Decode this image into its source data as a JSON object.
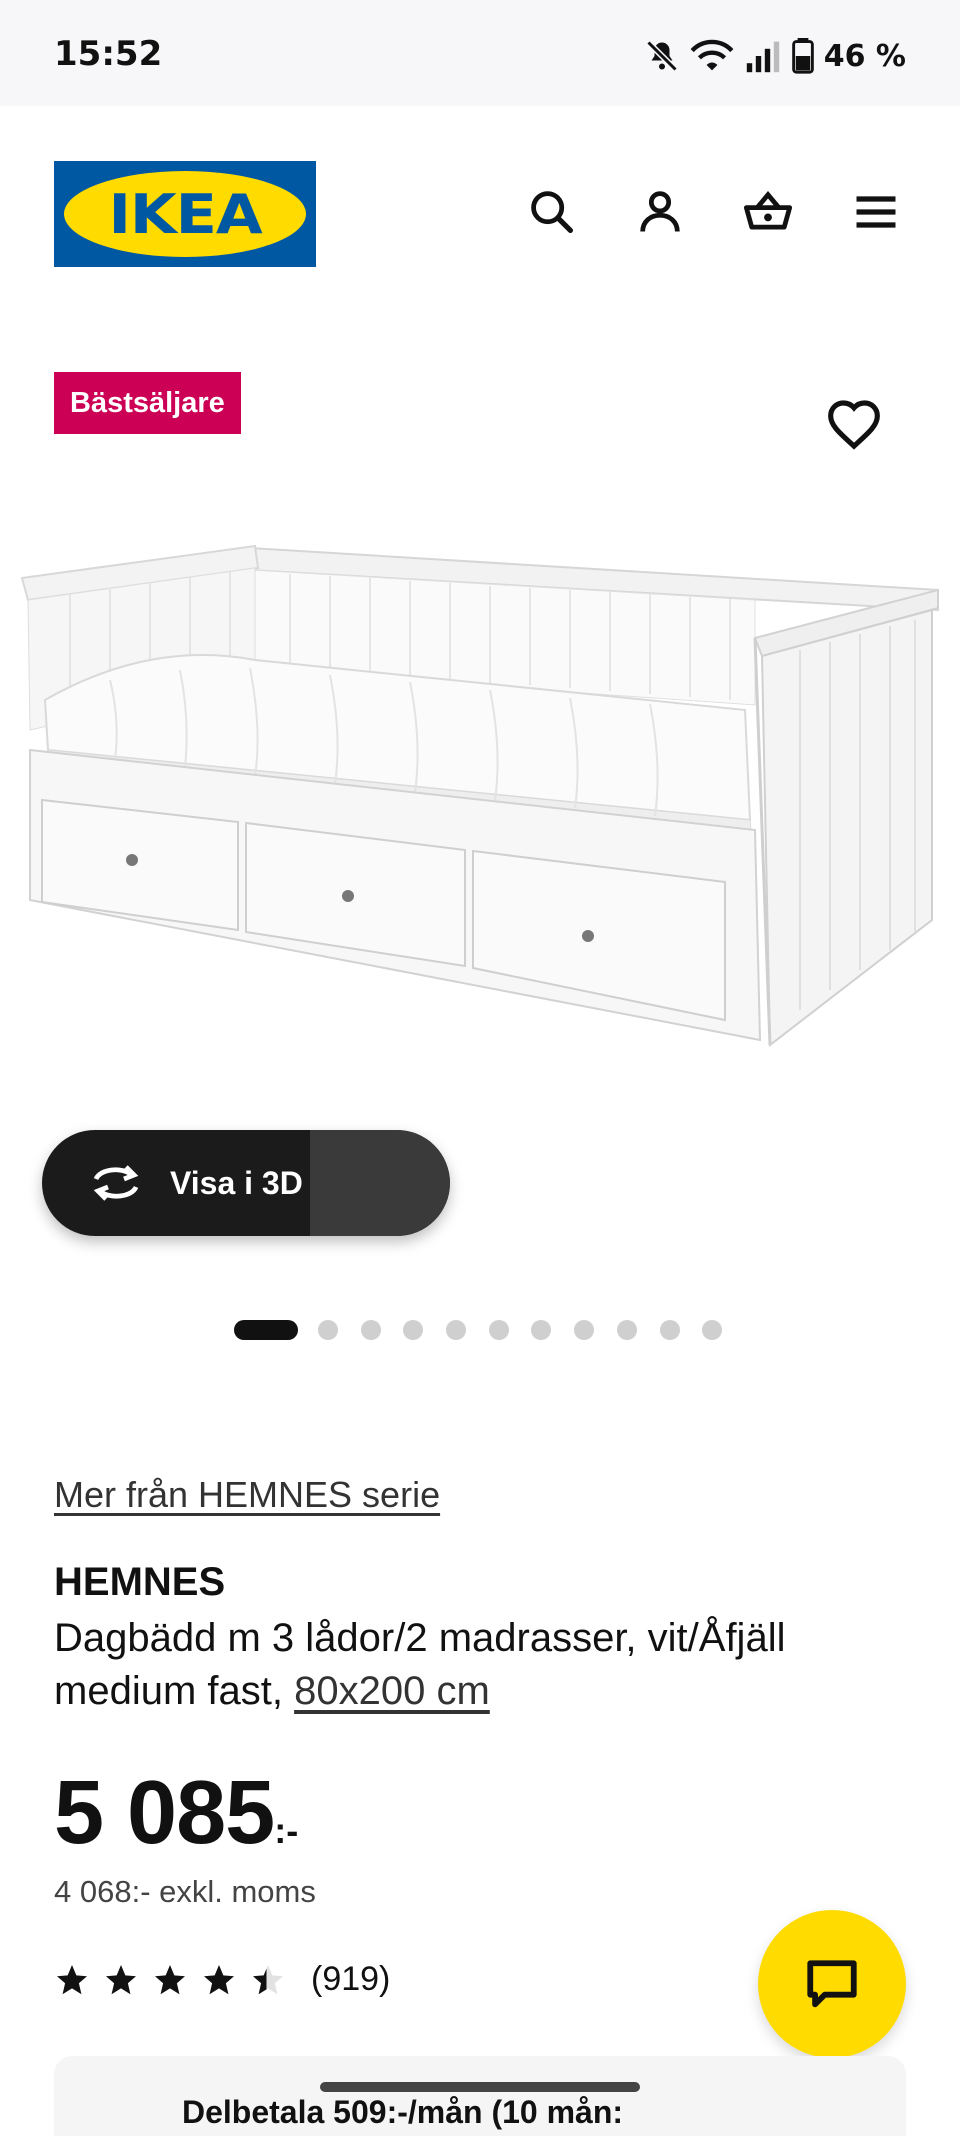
{
  "status_bar": {
    "time": "15:52",
    "battery_text": "46 %"
  },
  "header": {
    "logo_text": "IKEA",
    "icons": [
      "search-icon",
      "account-icon",
      "basket-icon",
      "menu-icon"
    ]
  },
  "product": {
    "badge": "Bästsäljare",
    "view_3d_label": "Visa i 3D",
    "image_count": 12,
    "active_image_index": 0,
    "series_link": "Mer från HEMNES serie",
    "name": "HEMNES",
    "description": "Dagbädd m 3 lådor/2 madrasser, vit/Åfjäll medium fast,",
    "size_link": "80x200 cm",
    "price_number": "5 085",
    "price_currency": ":-",
    "price_excl_vat": "4 068:- exkl. moms",
    "rating_value": 4.5,
    "rating_count": "(919)"
  },
  "bottom_card": {
    "text": "Delbetala 509:-/mån (10 mån:"
  },
  "colors": {
    "ikea_blue": "#0058a3",
    "ikea_yellow": "#ffdb00",
    "badge_red": "#cc0055"
  }
}
